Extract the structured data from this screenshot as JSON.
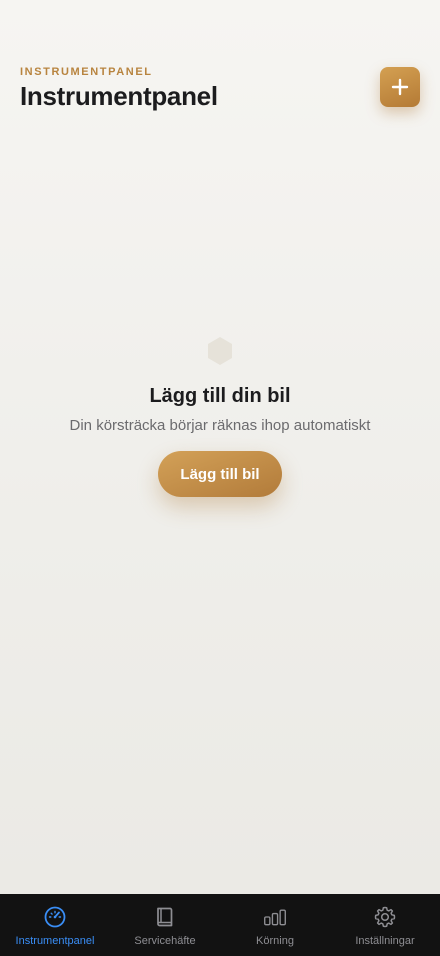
{
  "header": {
    "eyebrow": "INSTRUMENTPANEL",
    "title": "Instrumentpanel",
    "add_icon": "plus-icon"
  },
  "empty_state": {
    "icon": "hexagon-icon",
    "title": "Lägg till din bil",
    "subtitle": "Din körsträcka börjar räknas ihop automatiskt",
    "button_label": "Lägg till bil"
  },
  "tabbar": {
    "active_index": 0,
    "items": [
      {
        "label": "Instrumentpanel",
        "icon": "speedometer-icon"
      },
      {
        "label": "Servicehäfte",
        "icon": "book-icon"
      },
      {
        "label": "Körning",
        "icon": "bar-chart-icon"
      },
      {
        "label": "Inställningar",
        "icon": "gear-icon"
      }
    ]
  },
  "colors": {
    "accent": "#c48f47",
    "active_tab": "#3a8ef6",
    "tabbar_bg": "#121212"
  }
}
